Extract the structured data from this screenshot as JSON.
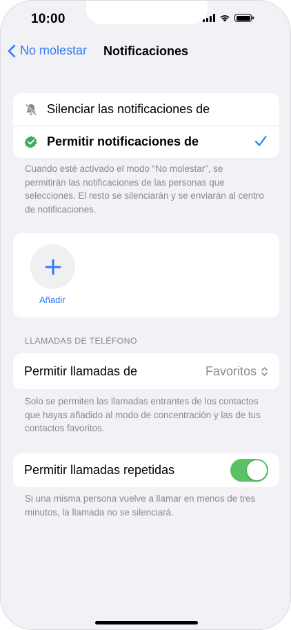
{
  "status_bar": {
    "time": "10:00"
  },
  "nav": {
    "back_label": "No molestar",
    "title": "Notificaciones"
  },
  "notification_mode": {
    "options": [
      {
        "label": "Silenciar las notificaciones de",
        "icon": "bell-slash-icon",
        "selected": false
      },
      {
        "label": "Permitir notificaciones de",
        "icon": "green-badge-check-icon",
        "selected": true
      }
    ],
    "footnote": "Cuando esté activado el modo “No molestar”, se permitirán las notificaciones de las personas que selecciones. El resto se silenciarán y se enviarán al centro de notificaciones."
  },
  "people": {
    "add_label": "Añadir"
  },
  "phone_calls": {
    "header": "LLAMADAS DE TELÉFONO",
    "allow_calls_label": "Permitir llamadas de",
    "allow_calls_value": "Favoritos",
    "allow_calls_footnote": "Solo se permiten las llamadas entrantes de los contactos que hayas añadido al modo de concentración y las de tus contactos favoritos.",
    "repeated_label": "Permitir llamadas repetidas",
    "repeated_enabled": true,
    "repeated_footnote": "Si una misma persona vuelve a llamar en menos de tres minutos, la llamada no se silenciará."
  },
  "colors": {
    "accent": "#2f7cf6",
    "toggle_on": "#5cc164",
    "badge_green": "#3dab58",
    "background": "#f2f1f6"
  }
}
